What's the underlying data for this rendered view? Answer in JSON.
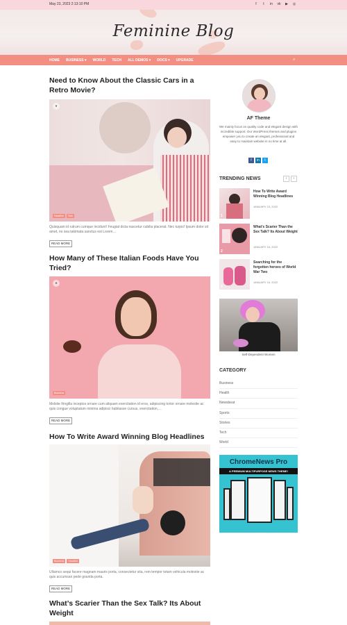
{
  "topbar": {
    "date": "May 23, 2023 2:13:10 PM",
    "socials": [
      "facebook-icon",
      "twitter-icon",
      "linkedin-icon",
      "vk-icon",
      "youtube-icon",
      "instagram-icon"
    ]
  },
  "header": {
    "logo": "Feminine Blog"
  },
  "nav": {
    "items": [
      "HOME",
      "BUSINESS ▾",
      "WORLD",
      "TECH",
      "ALL DEMOS ▾",
      "DOCS ▾",
      "UPGRADE"
    ],
    "search_icon": "search-icon"
  },
  "posts": [
    {
      "title": "Need to Know About the Classic Cars in a Retro Movie?",
      "categories": [
        "Headline",
        "Tech"
      ],
      "excerpt": "Quisquam id rutrum cumque incidunt! Feugiat dicta nascetur cubilia placerat. Nec turpis! Ipsum dolor sit amet, no sea takimata sanctus est Lorem…",
      "readmore": "READ MORE"
    },
    {
      "title": "How Many of These Italian Foods Have You Tried?",
      "categories": [
        "Business"
      ],
      "excerpt": "Molstie fringilla inceptos ornare cum aliquam exercitation id eros, adipiscing tortor ornare molestie ac quis congue voluptatum minima adipisci habitasse cursus, exercitation,…",
      "readmore": "READ MORE"
    },
    {
      "title": "How To Write Award Winning Blog Headlines",
      "categories": [
        "Business",
        "Headline"
      ],
      "excerpt": "Ullamco sequi facere magnam mauris porta, consectetur sita, rem tempor totam vehicula molestie ac quis accumsan pede gravida porta.",
      "readmore": "READ MORE"
    },
    {
      "title": "What’s Scarier Than the Sex Talk? Its About Weight"
    }
  ],
  "sidebar": {
    "author_name": "AF Theme",
    "author_desc": "We mainly focus on quality code and elegant design with incredible support. Our WordPress themes and plugins empower you to create an elegant, professional and easy to maintain website in no time at all.",
    "author_socials": [
      "facebook-icon",
      "linkedin-icon",
      "twitter-icon"
    ],
    "trending_title": "TRENDING NEWS",
    "trending": [
      {
        "num": "1",
        "title": "How To Write Award Winning Blog Headlines",
        "date": "JANUARY 15, 2022"
      },
      {
        "num": "2",
        "title": "What’s Scarier Than the Sex Talk? Its About Weight",
        "date": "JANUARY 16, 2022"
      },
      {
        "num": "3",
        "title": "Searching for the forgotten heroes of World War Two",
        "date": "JANUARY 16, 2022"
      }
    ],
    "feature_caption": "Self-Dependent Women",
    "category_title": "CATEGORY",
    "categories": [
      "Business",
      "Health",
      "Newsbeat",
      "Sports",
      "Stories",
      "Tech",
      "World"
    ],
    "ad": {
      "title": "ChromeNews Pro",
      "strip": "A PREMIUM MULTIPURPOSE NEWS THEME!"
    }
  },
  "colors": {
    "accent": "#f28e82",
    "topbar": "#f9d8dd",
    "ad_bg": "#35c2d1"
  }
}
